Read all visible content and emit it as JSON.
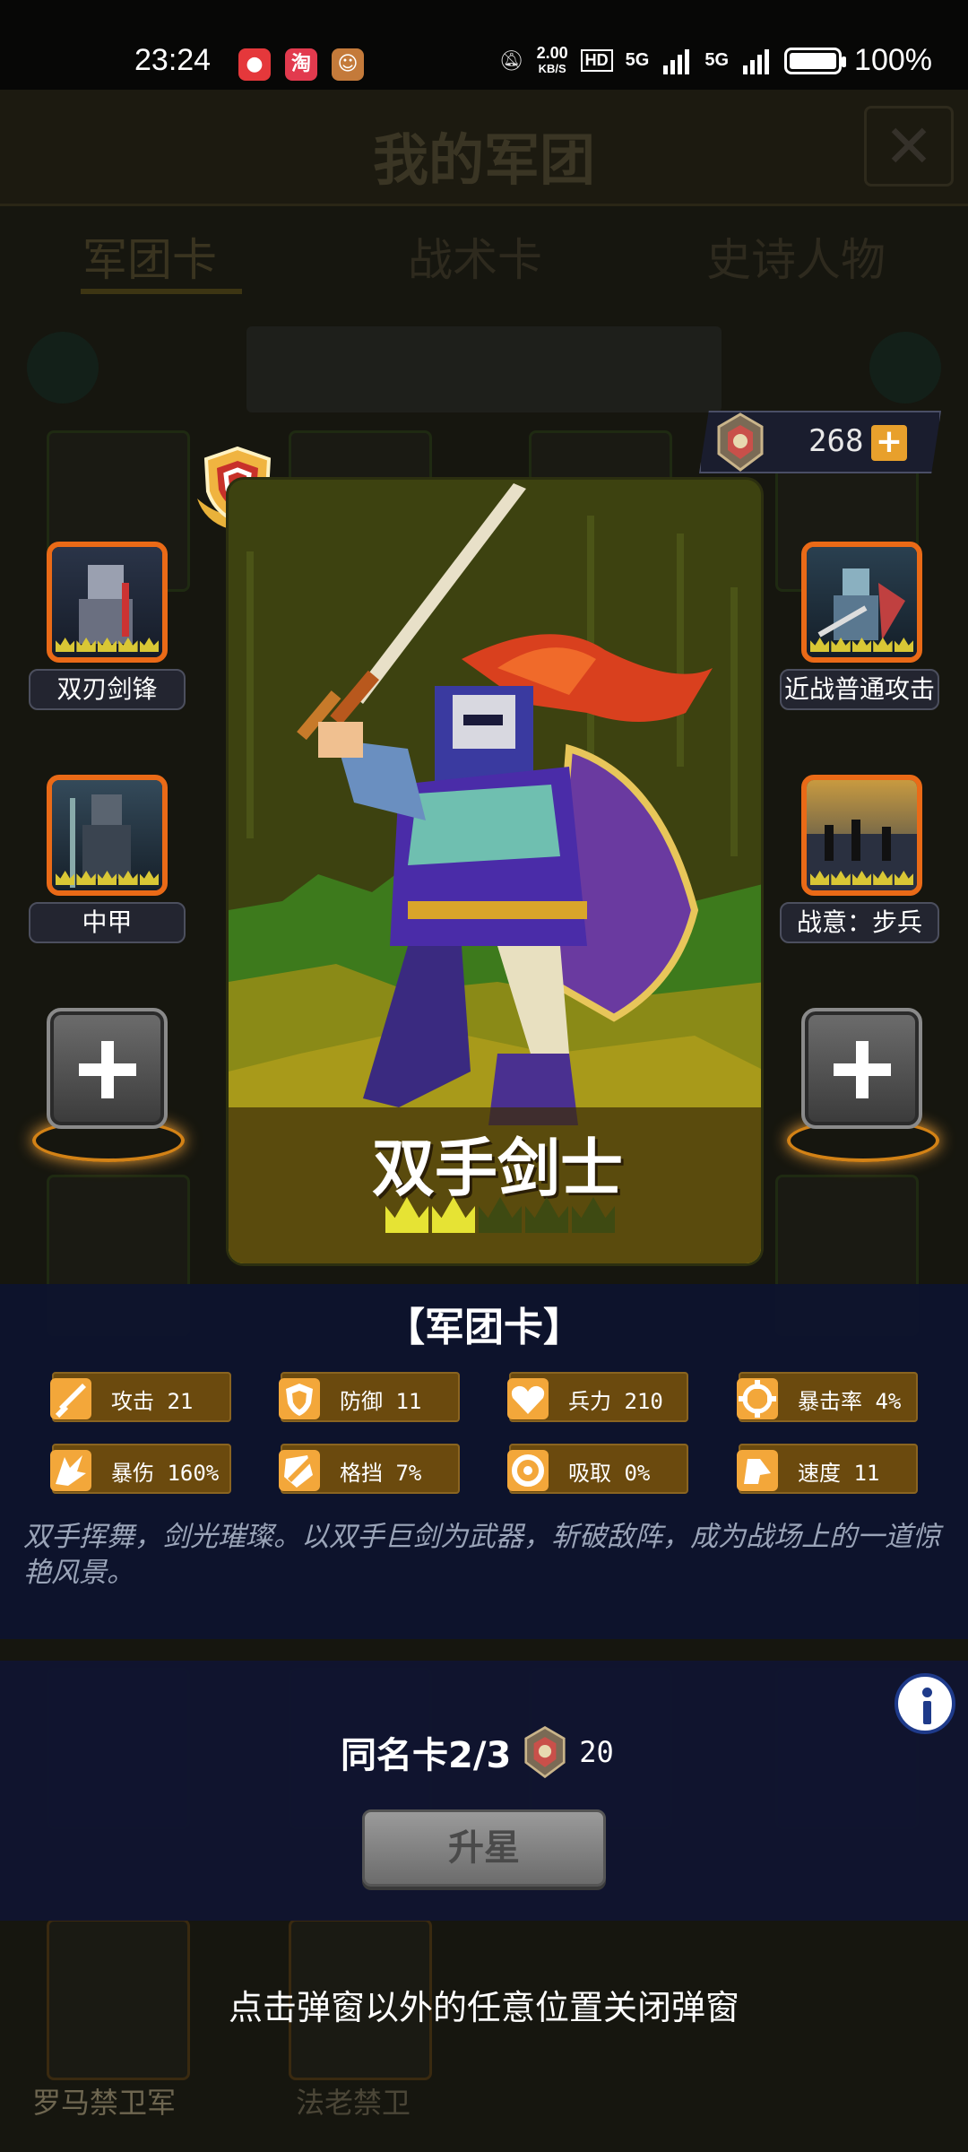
{
  "status_bar": {
    "time": "23:24",
    "net_speed_value": "2.00",
    "net_speed_unit": "KB/S",
    "hd_badge": "HD",
    "signal_1": "5G",
    "signal_2": "5G",
    "battery": "100%",
    "icons": [
      "dnd-muted-icon",
      "signal-icon",
      "battery-icon"
    ]
  },
  "background": {
    "title": "我的军团",
    "tabs": [
      "军团卡",
      "战术卡",
      "史诗人物"
    ],
    "labels": [
      "双刃剑锋",
      "近战普通攻击",
      "中甲",
      "战意：步兵",
      "罗马禁卫军",
      "法老禁卫"
    ]
  },
  "currency": {
    "value": "268",
    "plus": "+"
  },
  "skills": {
    "left_top": {
      "name": "双刃剑锋"
    },
    "left_mid": {
      "name": "中甲"
    },
    "right_top": {
      "name": "近战普通攻击"
    },
    "right_mid": {
      "name": "战意：步兵"
    }
  },
  "card": {
    "name": "双手剑士",
    "stars_filled": 2,
    "stars_total": 5,
    "accent": "#e6e334"
  },
  "info": {
    "title": "【军团卡】",
    "stats": [
      {
        "icon": "sword-icon",
        "text": "攻击 21"
      },
      {
        "icon": "shield-icon",
        "text": "防御 11"
      },
      {
        "icon": "heart-icon",
        "text": "兵力 210"
      },
      {
        "icon": "crit-rate-icon",
        "text": "暴击率 4%"
      },
      {
        "icon": "crit-damage-icon",
        "text": "暴伤 160%"
      },
      {
        "icon": "block-icon",
        "text": "格挡 7%"
      },
      {
        "icon": "lifesteal-icon",
        "text": "吸取 0%"
      },
      {
        "icon": "speed-icon",
        "text": "速度 11"
      }
    ],
    "description": "双手挥舞，剑光璀璨。以双手巨剑为武器，斩破敌阵，成为战场上的一道惊艳风景。"
  },
  "upgrade": {
    "duplicate_label": "同名卡2/3",
    "cost": "20",
    "button": "升星"
  },
  "hint": "点击弹窗以外的任意位置关闭弹窗"
}
